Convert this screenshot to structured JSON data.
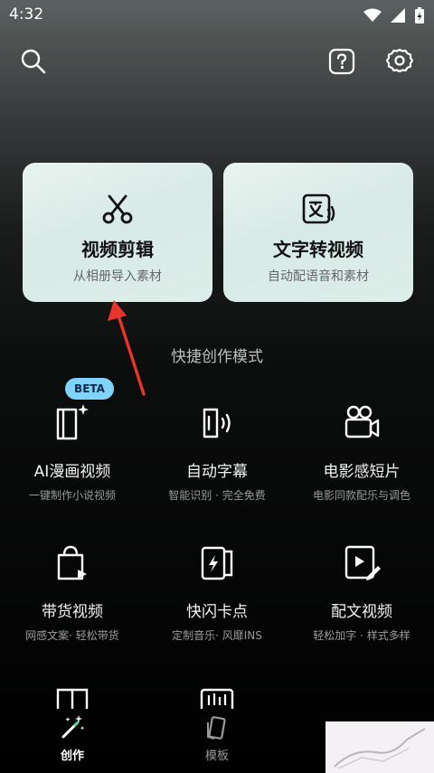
{
  "status": {
    "time": "4:32"
  },
  "topbar": {
    "search_icon": "search-icon",
    "help_icon": "help-icon",
    "settings_icon": "gear-icon"
  },
  "cards": [
    {
      "title": "视频剪辑",
      "subtitle": "从相册导入素材",
      "icon": "scissors-icon"
    },
    {
      "title": "文字转视频",
      "subtitle": "自动配语音和素材",
      "icon": "text-to-speech-icon"
    }
  ],
  "section_title": "快捷创作模式",
  "grid": [
    {
      "title": "AI漫画视频",
      "subtitle": "一键制作小说视频",
      "badge": "BETA",
      "icon": "comic-book-icon"
    },
    {
      "title": "自动字幕",
      "subtitle": "智能识别 · 完全免费",
      "icon": "voice-subtitle-icon"
    },
    {
      "title": "电影感短片",
      "subtitle": "电影同款配乐与调色",
      "icon": "movie-camera-icon"
    },
    {
      "title": "带货视频",
      "subtitle": "网感文案· 轻松带货",
      "icon": "shopping-bag-icon"
    },
    {
      "title": "快闪卡点",
      "subtitle": "定制音乐· 风靡INS",
      "icon": "flash-card-icon"
    },
    {
      "title": "配文视频",
      "subtitle": "轻松加字 · 样式多样",
      "icon": "video-edit-icon"
    }
  ],
  "nav": [
    {
      "label": "创作",
      "icon": "magic-wand-icon",
      "active": true
    },
    {
      "label": "模板",
      "icon": "template-icon",
      "active": false
    }
  ],
  "colors": {
    "card_bg": "#dcece8",
    "beta_badge": "#7fd3ff",
    "arrow": "#e8352b"
  }
}
